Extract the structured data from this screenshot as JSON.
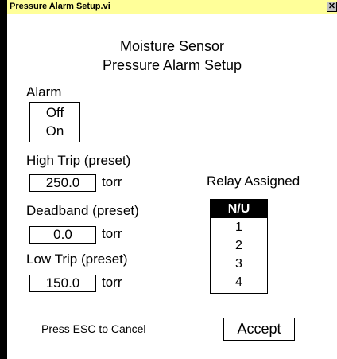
{
  "window": {
    "title": "Pressure Alarm Setup.vi",
    "close_glyph": "✕"
  },
  "header": {
    "line1": "Moisture Sensor",
    "line2": "Pressure Alarm Setup"
  },
  "alarm": {
    "label": "Alarm",
    "options": [
      "Off",
      "On"
    ]
  },
  "high_trip": {
    "label": "High Trip (preset)",
    "value": "250.0",
    "unit": "torr"
  },
  "deadband": {
    "label": "Deadband (preset)",
    "value": "0.0",
    "unit": "torr"
  },
  "low_trip": {
    "label": "Low Trip (preset)",
    "value": "150.0",
    "unit": "torr"
  },
  "relay": {
    "label": "Relay Assigned",
    "options": [
      "N/U",
      "1",
      "2",
      "3",
      "4"
    ],
    "selected": "N/U"
  },
  "footer": {
    "esc_text": "Press ESC to Cancel",
    "accept_label": "Accept"
  },
  "colors": {
    "titlebar": "#ffff99",
    "selection": "#000000"
  }
}
